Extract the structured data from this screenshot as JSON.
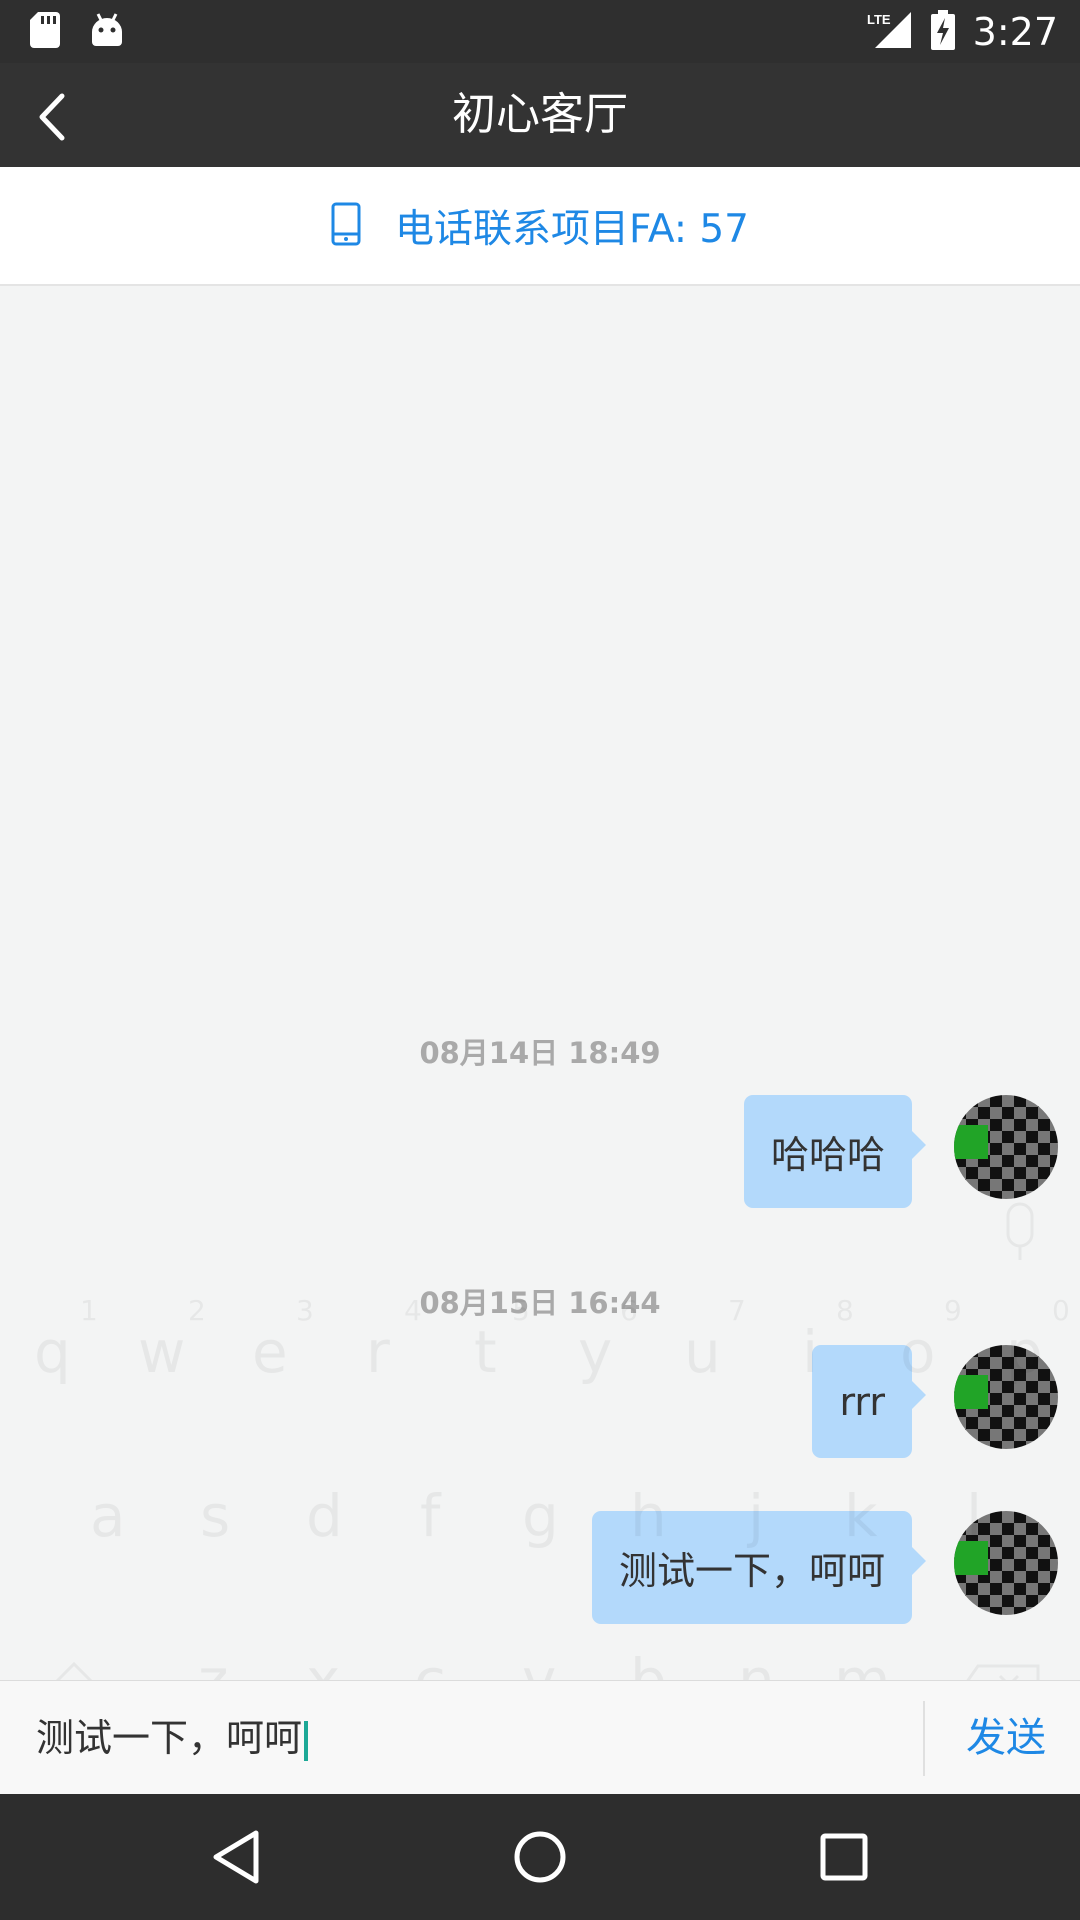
{
  "status_bar": {
    "time": "3:27",
    "network": "LTE",
    "icons_left": [
      "sd-card-icon",
      "android-icon"
    ],
    "icons_right": [
      "lte-signal-icon",
      "battery-charging-icon"
    ]
  },
  "app_bar": {
    "title": "初心客厅",
    "back_icon": "chevron-left-icon"
  },
  "contact": {
    "icon": "phone-icon",
    "text": "电话联系项目FA: 57"
  },
  "messages": [
    {
      "timestamp": "08月14日 18:49",
      "text": "哈哈哈"
    },
    {
      "timestamp": "08月15日 16:44",
      "text": "rrr"
    },
    {
      "timestamp": "",
      "text": "测试一下，呵呵"
    }
  ],
  "input": {
    "value": "测试一下，呵呵",
    "send_label": "发送"
  },
  "colors": {
    "accent": "#1e88e5",
    "bubble": "#b3d9fb",
    "appbar": "#333333",
    "status_bar": "#2f2f2f",
    "background": "#f3f4f4"
  }
}
